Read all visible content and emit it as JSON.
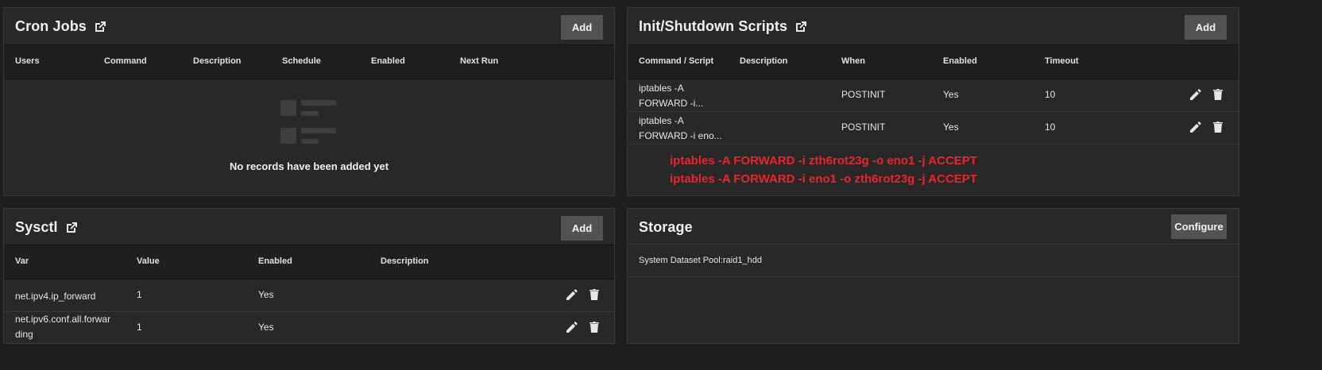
{
  "cron": {
    "title": "Cron Jobs",
    "add_label": "Add",
    "columns": [
      "Users",
      "Command",
      "Description",
      "Schedule",
      "Enabled",
      "Next Run"
    ],
    "empty_text": "No records have been added yet"
  },
  "init": {
    "title": "Init/Shutdown Scripts",
    "add_label": "Add",
    "columns": [
      "Command / Script",
      "Description",
      "When",
      "Enabled",
      "Timeout"
    ],
    "rows": [
      {
        "command_line1": "iptables -A",
        "command_line2": "FORWARD -i...",
        "description": "",
        "when": "POSTINIT",
        "enabled": "Yes",
        "timeout": "10"
      },
      {
        "command_line1": "iptables -A",
        "command_line2": "FORWARD -i eno...",
        "description": "",
        "when": "POSTINIT",
        "enabled": "Yes",
        "timeout": "10"
      }
    ],
    "annotation": [
      "iptables -A FORWARD -i zth6rot23g -o eno1 -j ACCEPT",
      "iptables -A FORWARD -i eno1 -o zth6rot23g -j ACCEPT"
    ],
    "annotation_color": "#e8252d"
  },
  "sysctl": {
    "title": "Sysctl",
    "add_label": "Add",
    "columns": [
      "Var",
      "Value",
      "Enabled",
      "Description"
    ],
    "rows": [
      {
        "var_line1": "net.ipv4.ip_forward",
        "var_line2": "",
        "value": "1",
        "enabled": "Yes",
        "description": ""
      },
      {
        "var_line1": "net.ipv6.conf.all.forwar",
        "var_line2": "ding",
        "value": "1",
        "enabled": "Yes",
        "description": ""
      }
    ]
  },
  "storage": {
    "title": "Storage",
    "configure_label": "Configure",
    "pool_label": "System Dataset Pool:",
    "pool_value": "raid1_hdd"
  },
  "icons": {
    "external_link": "external-link-icon",
    "edit": "pencil-icon",
    "delete": "trash-icon",
    "empty": "empty-list-icon"
  }
}
